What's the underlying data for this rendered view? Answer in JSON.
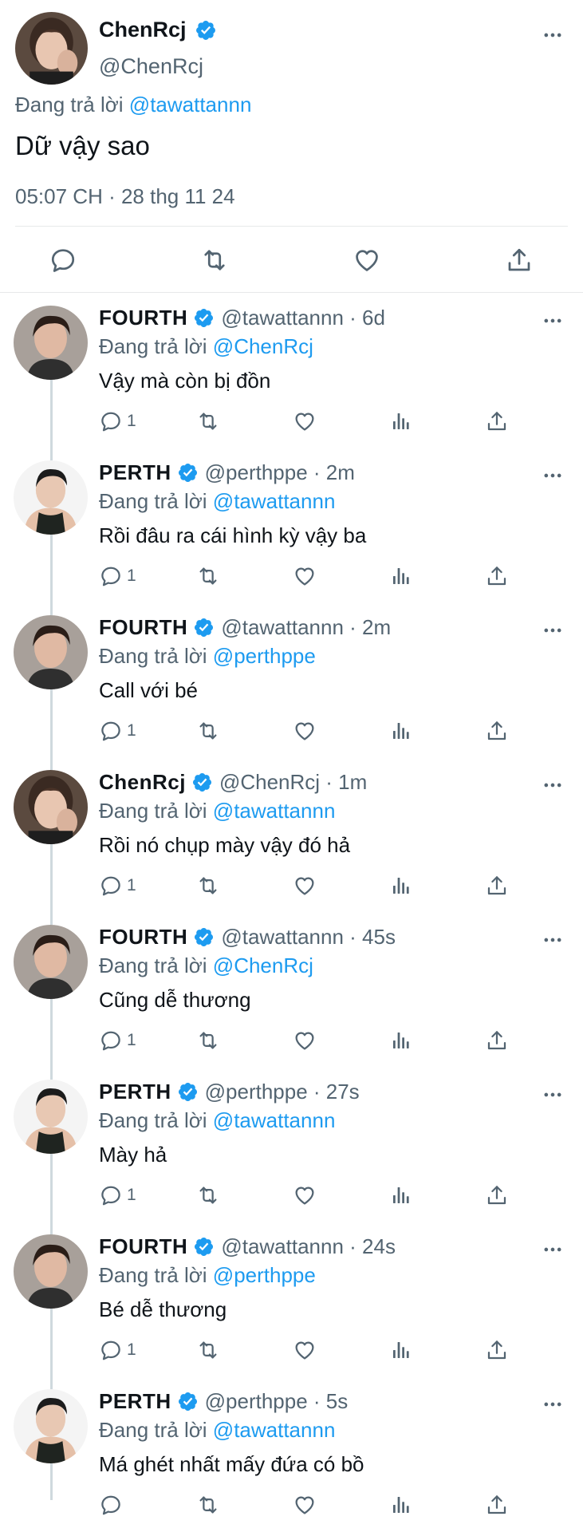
{
  "main_tweet": {
    "name": "ChenRcj",
    "handle": "@ChenRcj",
    "reply_prefix": "Đang trả lời",
    "reply_to": "@tawattannn",
    "text": "Dữ vậy sao",
    "timestamp": "05:07 CH · 28 thg 11 24"
  },
  "replies": [
    {
      "name": "FOURTH",
      "meta": "@tawattannn · 6d",
      "reply_prefix": "Đang trả lời",
      "reply_to": "@ChenRcj",
      "text": "Vậy mà còn bị đồn",
      "reply_count": "1",
      "avatar": "fourth"
    },
    {
      "name": "PERTH",
      "meta": "@perthppe · 2m",
      "reply_prefix": "Đang trả lời",
      "reply_to": "@tawattannn",
      "text": "Rồi đâu ra cái hình kỳ vậy ba",
      "reply_count": "1",
      "avatar": "perth"
    },
    {
      "name": "FOURTH",
      "meta": "@tawattannn · 2m",
      "reply_prefix": "Đang trả lời",
      "reply_to": "@perthppe",
      "text": "Call với bé",
      "reply_count": "1",
      "avatar": "fourth"
    },
    {
      "name": "ChenRcj",
      "meta": "@ChenRcj · 1m",
      "reply_prefix": "Đang trả lời",
      "reply_to": "@tawattannn",
      "text": "Rồi nó chụp mày vậy đó hả",
      "reply_count": "1",
      "avatar": "chen"
    },
    {
      "name": "FOURTH",
      "meta": "@tawattannn · 45s",
      "reply_prefix": "Đang trả lời",
      "reply_to": "@ChenRcj",
      "text": "Cũng dễ thương",
      "reply_count": "1",
      "avatar": "fourth"
    },
    {
      "name": "PERTH",
      "meta": "@perthppe · 27s",
      "reply_prefix": "Đang trả lời",
      "reply_to": "@tawattannn",
      "text": "Mày hả",
      "reply_count": "1",
      "avatar": "perth"
    },
    {
      "name": "FOURTH",
      "meta": "@tawattannn · 24s",
      "reply_prefix": "Đang trả lời",
      "reply_to": "@perthppe",
      "text": "Bé dễ thương",
      "reply_count": "1",
      "avatar": "fourth"
    },
    {
      "name": "PERTH",
      "meta": "@perthppe · 5s",
      "reply_prefix": "Đang trả lời",
      "reply_to": "@tawattannn",
      "text": "Má ghét nhất mấy đứa có bồ",
      "reply_count": "",
      "avatar": "perth"
    }
  ],
  "colors": {
    "text": "#0f1419",
    "secondary": "#536471",
    "accent": "#1d9bf0",
    "divider": "#e7e9ea",
    "thread_line": "#cfd9de"
  }
}
